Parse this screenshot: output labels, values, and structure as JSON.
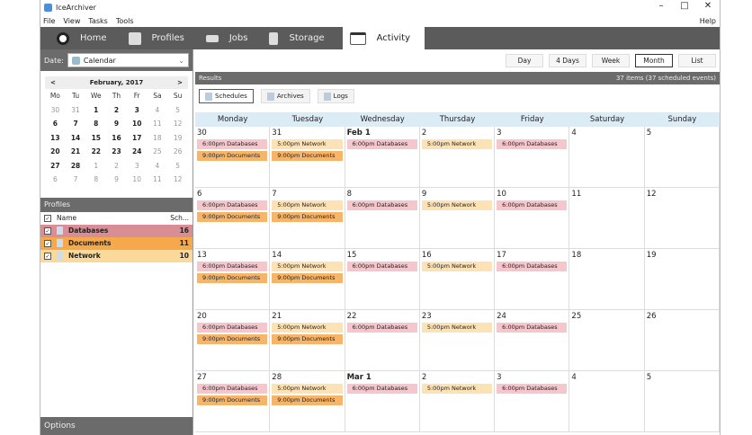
{
  "app": {
    "title": "IceArchiver",
    "help": "Help"
  },
  "menu": [
    "File",
    "View",
    "Tasks",
    "Tools"
  ],
  "tabs": [
    {
      "label": "Home",
      "icon": "home-icon"
    },
    {
      "label": "Profiles",
      "icon": "profiles-icon"
    },
    {
      "label": "Jobs",
      "icon": "jobs-icon"
    },
    {
      "label": "Storage",
      "icon": "storage-icon"
    },
    {
      "label": "Activity",
      "icon": "activity-icon",
      "active": true
    }
  ],
  "left": {
    "date_label": "Date:",
    "date_value": "Calendar",
    "month_title": "February, 2017",
    "prev": "<",
    "next": ">",
    "dow": [
      "Mo",
      "Tu",
      "We",
      "Th",
      "Fr",
      "Sa",
      "Su"
    ],
    "days": [
      [
        "30",
        "oth"
      ],
      [
        "31",
        "oth"
      ],
      [
        "1",
        "cur"
      ],
      [
        "2",
        "cur"
      ],
      [
        "3",
        "cur"
      ],
      [
        "4",
        "oth"
      ],
      [
        "5",
        "oth"
      ],
      [
        "6",
        "cur"
      ],
      [
        "7",
        "cur"
      ],
      [
        "8",
        "cur"
      ],
      [
        "9",
        "cur"
      ],
      [
        "10",
        "cur"
      ],
      [
        "11",
        "oth"
      ],
      [
        "12",
        "oth"
      ],
      [
        "13",
        "cur"
      ],
      [
        "14",
        "cur"
      ],
      [
        "15",
        "cur"
      ],
      [
        "16",
        "cur"
      ],
      [
        "17",
        "cur"
      ],
      [
        "18",
        "oth"
      ],
      [
        "19",
        "oth"
      ],
      [
        "20",
        "cur"
      ],
      [
        "21",
        "cur"
      ],
      [
        "22",
        "cur"
      ],
      [
        "23",
        "cur"
      ],
      [
        "24",
        "cur"
      ],
      [
        "25",
        "oth"
      ],
      [
        "26",
        "oth"
      ],
      [
        "27",
        "cur"
      ],
      [
        "28",
        "cur"
      ],
      [
        "1",
        "oth"
      ],
      [
        "2",
        "oth"
      ],
      [
        "3",
        "oth"
      ],
      [
        "4",
        "oth"
      ],
      [
        "5",
        "oth"
      ],
      [
        "6",
        "oth"
      ],
      [
        "7",
        "oth"
      ],
      [
        "8",
        "oth"
      ],
      [
        "9",
        "oth"
      ],
      [
        "10",
        "oth"
      ],
      [
        "11",
        "oth"
      ],
      [
        "12",
        "oth"
      ]
    ],
    "profiles_title": "Profiles",
    "col_name": "Name",
    "col_sch": "Sch...",
    "profiles": [
      {
        "name": "Databases",
        "count": "16",
        "color": "#d98d94"
      },
      {
        "name": "Documents",
        "count": "11",
        "color": "#f6a94b"
      },
      {
        "name": "Network",
        "count": "10",
        "color": "#fbd99a"
      }
    ],
    "options": "Options"
  },
  "views": [
    {
      "label": "Day"
    },
    {
      "label": "4 Days"
    },
    {
      "label": "Week"
    },
    {
      "label": "Month",
      "selected": true
    },
    {
      "label": "List"
    }
  ],
  "results": {
    "title": "Results",
    "summary": "37 items (37 scheduled events)"
  },
  "toolbar": [
    {
      "label": "Schedules",
      "selected": true
    },
    {
      "label": "Archives"
    },
    {
      "label": "Logs"
    }
  ],
  "weekdays": [
    "Monday",
    "Tuesday",
    "Wednesday",
    "Thursday",
    "Friday",
    "Saturday",
    "Sunday"
  ],
  "event_colors": {
    "Databases": "#f5c6cc",
    "Documents": "#f7b56a",
    "Network": "#fde2b5"
  },
  "weeks": [
    [
      "30",
      "31",
      "Feb 1",
      "2",
      "3",
      "4",
      "5"
    ],
    [
      "6",
      "7",
      "8",
      "9",
      "10",
      "11",
      "12"
    ],
    [
      "13",
      "14",
      "15",
      "16",
      "17",
      "18",
      "19"
    ],
    [
      "20",
      "21",
      "22",
      "23",
      "24",
      "25",
      "26"
    ],
    [
      "27",
      "28",
      "Mar 1",
      "2",
      "3",
      "4",
      "5"
    ]
  ],
  "day_events": [
    [
      {
        "t": "6:00pm Databases",
        "p": "Databases"
      },
      {
        "t": "9:00pm Documents",
        "p": "Documents"
      }
    ],
    [
      {
        "t": "5:00pm Network",
        "p": "Network"
      },
      {
        "t": "9:00pm Documents",
        "p": "Documents"
      }
    ],
    [
      {
        "t": "6:00pm Databases",
        "p": "Databases"
      }
    ],
    [
      {
        "t": "5:00pm Network",
        "p": "Network"
      }
    ],
    [
      {
        "t": "6:00pm Databases",
        "p": "Databases"
      }
    ],
    [],
    []
  ]
}
